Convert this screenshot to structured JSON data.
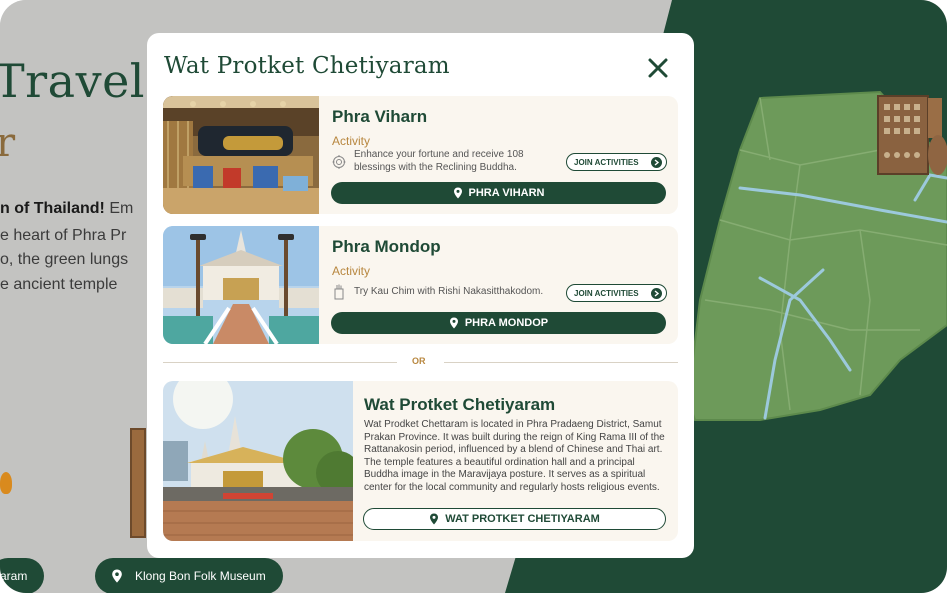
{
  "background": {
    "hero_title_line1": "Travel",
    "hero_title_line2": "r",
    "intro_line1_bold": "n of Thailand!",
    "intro_line1_rest": " Em",
    "intro_line2": "e heart of Phra Pr",
    "intro_line3": "o, the green lungs",
    "intro_line4": "e ancient temple",
    "pill_left": "aram",
    "pill_right": "Klong Bon Folk Museum"
  },
  "modal": {
    "title": "Wat Protket Chetiyaram",
    "close_icon": "close-icon",
    "or_label": "OR",
    "cards": [
      {
        "title": "Phra Viharn",
        "activity_label": "Activity",
        "activity_icon": "lotus-icon",
        "activity_text": "Enhance your fortune and receive 108 blessings with the Reclining Buddha.",
        "join_label": "JOIN ACTIVITIES",
        "button_label": "PHRA VIHARN"
      },
      {
        "title": "Phra Mondop",
        "activity_label": "Activity",
        "activity_icon": "fortune-stick-icon",
        "activity_text": "Try Kau Chim with Rishi Nakasitthakodom.",
        "join_label": "JOIN ACTIVITIES",
        "button_label": "PHRA MONDOP"
      }
    ],
    "main_place": {
      "title": "Wat Protket Chetiyaram",
      "description": "Wat Prodket Chettaram is located in Phra Pradaeng District, Samut Prakan Province. It was built during the reign of King Rama III of the Rattanakosin period, influenced by a blend of Chinese and Thai art. The temple features a beautiful ordination hall and a principal Buddha image in the Maravijaya posture. It serves as a spiritual center for the local community and regularly hosts religious events.",
      "button_label": "WAT PROTKET CHETIYARAM"
    }
  },
  "colors": {
    "brand_green": "#1f4a36",
    "accent_gold": "#b8873f",
    "card_bg": "#faf6ef",
    "map_green": "#6d9a5a",
    "river_blue": "#9cc9dc"
  }
}
